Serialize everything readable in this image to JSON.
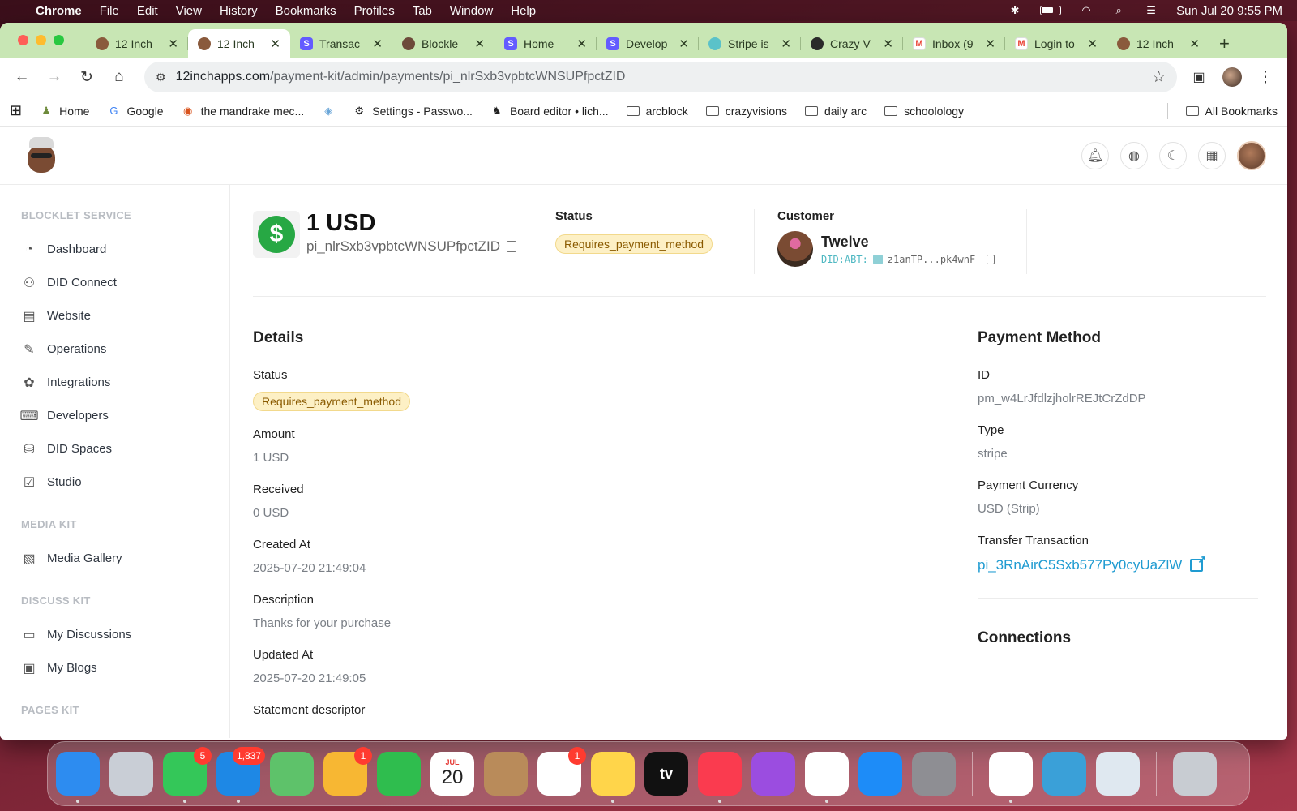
{
  "menubar": {
    "app": "Chrome",
    "items": [
      "File",
      "Edit",
      "View",
      "History",
      "Bookmarks",
      "Profiles",
      "Tab",
      "Window",
      "Help"
    ],
    "datetime": "Sun Jul 20  9:55 PM"
  },
  "tabs": [
    {
      "label": "12 Inch",
      "icon": "face-favicon",
      "active": false
    },
    {
      "label": "12 Inch",
      "icon": "face-favicon",
      "active": true
    },
    {
      "label": "Transac",
      "icon": "stripe-favicon",
      "active": false
    },
    {
      "label": "Blockle",
      "icon": "blocklet-favicon",
      "active": false
    },
    {
      "label": "Home –",
      "icon": "stripe-favicon",
      "active": false
    },
    {
      "label": "Develop",
      "icon": "stripe-favicon",
      "active": false
    },
    {
      "label": "Stripe is",
      "icon": "wheel-favicon",
      "active": false
    },
    {
      "label": "Crazy V",
      "icon": "crazy-favicon",
      "active": false
    },
    {
      "label": "Inbox (9",
      "icon": "gmail-favicon",
      "active": false
    },
    {
      "label": "Login to",
      "icon": "gmail-favicon",
      "active": false
    },
    {
      "label": "12 Inch",
      "icon": "face-favicon",
      "active": false
    }
  ],
  "omnibox": {
    "host": "12inchapps.com",
    "path": "/payment-kit/admin/payments/pi_nlrSxb3vpbtcWNSUPfpctZID"
  },
  "bookmarks": [
    {
      "label": "Home",
      "icon": "person-icon"
    },
    {
      "label": "Google",
      "icon": "google-icon"
    },
    {
      "label": "the mandrake mec...",
      "icon": "site-icon"
    },
    {
      "label": "",
      "icon": "tag-icon"
    },
    {
      "label": "Settings - Passwo...",
      "icon": "gear-icon"
    },
    {
      "label": "Board editor • lich...",
      "icon": "chess-icon"
    },
    {
      "label": "arcblock",
      "icon": "folder-icon"
    },
    {
      "label": "crazyvisions",
      "icon": "folder-icon"
    },
    {
      "label": "daily arc",
      "icon": "folder-icon"
    },
    {
      "label": "schoolology",
      "icon": "folder-icon"
    }
  ],
  "all_bookmarks": "All Bookmarks",
  "sidebar": {
    "sections": [
      {
        "title": "BLOCKLET SERVICE",
        "items": [
          {
            "label": "Dashboard",
            "icon": "gauge-icon"
          },
          {
            "label": "DID Connect",
            "icon": "users-icon"
          },
          {
            "label": "Website",
            "icon": "website-icon"
          },
          {
            "label": "Operations",
            "icon": "wrench-icon"
          },
          {
            "label": "Integrations",
            "icon": "integrations-icon"
          },
          {
            "label": "Developers",
            "icon": "terminal-icon"
          },
          {
            "label": "DID Spaces",
            "icon": "storage-icon"
          },
          {
            "label": "Studio",
            "icon": "studio-icon"
          }
        ]
      },
      {
        "title": "MEDIA KIT",
        "items": [
          {
            "label": "Media Gallery",
            "icon": "gallery-icon"
          }
        ]
      },
      {
        "title": "DISCUSS KIT",
        "items": [
          {
            "label": "My Discussions",
            "icon": "chat-icon"
          },
          {
            "label": "My Blogs",
            "icon": "blog-icon"
          }
        ]
      },
      {
        "title": "PAGES KIT",
        "items": []
      }
    ]
  },
  "summary": {
    "amount": "1 USD",
    "payment_id": "pi_nlrSxb3vpbtcWNSUPfpctZID",
    "status_label": "Status",
    "status": "Requires_payment_method",
    "customer_label": "Customer",
    "customer_name": "Twelve",
    "customer_did_prefix": "DID:ABT:",
    "customer_did": "z1anTP...pk4wnF"
  },
  "details": {
    "title": "Details",
    "fields": [
      {
        "label": "Status",
        "value": "Requires_payment_method",
        "badge": true
      },
      {
        "label": "Amount",
        "value": "1 USD"
      },
      {
        "label": "Received",
        "value": "0 USD"
      },
      {
        "label": "Created At",
        "value": "2025-07-20 21:49:04"
      },
      {
        "label": "Description",
        "value": "Thanks for your purchase"
      },
      {
        "label": "Updated At",
        "value": "2025-07-20 21:49:05"
      },
      {
        "label": "Statement descriptor",
        "value": ""
      }
    ]
  },
  "payment_method": {
    "title": "Payment Method",
    "fields": [
      {
        "label": "ID",
        "value": "pm_w4LrJfdlzjholrREJtCrZdDP"
      },
      {
        "label": "Type",
        "value": "stripe"
      },
      {
        "label": "Payment Currency",
        "value": "USD (Strip)"
      }
    ],
    "transfer_label": "Transfer Transaction",
    "transfer_value": "pi_3RnAirC5Sxb577Py0cyUaZlW",
    "connections_title": "Connections"
  },
  "dock": {
    "apps": [
      {
        "name": "finder",
        "color": "#2d8cf0",
        "badge": "",
        "running": true
      },
      {
        "name": "launchpad",
        "color": "#c9ced6",
        "badge": "",
        "running": false
      },
      {
        "name": "messages",
        "color": "#34c759",
        "badge": "5",
        "running": true
      },
      {
        "name": "mail",
        "color": "#1e88e5",
        "badge": "1,837",
        "running": true
      },
      {
        "name": "maps",
        "color": "#5ec26a",
        "badge": "",
        "running": false
      },
      {
        "name": "photos",
        "color": "#f7b733",
        "badge": "1",
        "running": false
      },
      {
        "name": "facetime",
        "color": "#2fbd4e",
        "badge": "",
        "running": false
      },
      {
        "name": "calendar",
        "color": "#ffffff",
        "badge": "",
        "running": false,
        "text": "20",
        "month": "JUL"
      },
      {
        "name": "contacts",
        "color": "#b98b5a",
        "badge": "",
        "running": false
      },
      {
        "name": "reminders",
        "color": "#ffffff",
        "badge": "1",
        "running": false
      },
      {
        "name": "notes",
        "color": "#ffd54a",
        "badge": "",
        "running": true
      },
      {
        "name": "tv",
        "color": "#111111",
        "badge": "",
        "running": false,
        "text": "tv"
      },
      {
        "name": "music",
        "color": "#fa3b4f",
        "badge": "",
        "running": true
      },
      {
        "name": "podcasts",
        "color": "#9b4de0",
        "badge": "",
        "running": false
      },
      {
        "name": "news",
        "color": "#ffffff",
        "badge": "",
        "running": true
      },
      {
        "name": "app-store",
        "color": "#1d8cf8",
        "badge": "",
        "running": false
      },
      {
        "name": "system-settings",
        "color": "#8e8e93",
        "badge": "",
        "running": false
      }
    ],
    "recent": [
      {
        "name": "chrome",
        "color": "#ffffff",
        "running": true
      },
      {
        "name": "quicktime",
        "color": "#3aa0d8",
        "running": false
      },
      {
        "name": "preview",
        "color": "#dfe8f0",
        "running": false
      }
    ],
    "trash": {
      "name": "trash",
      "color": "#c8ccd2"
    }
  }
}
